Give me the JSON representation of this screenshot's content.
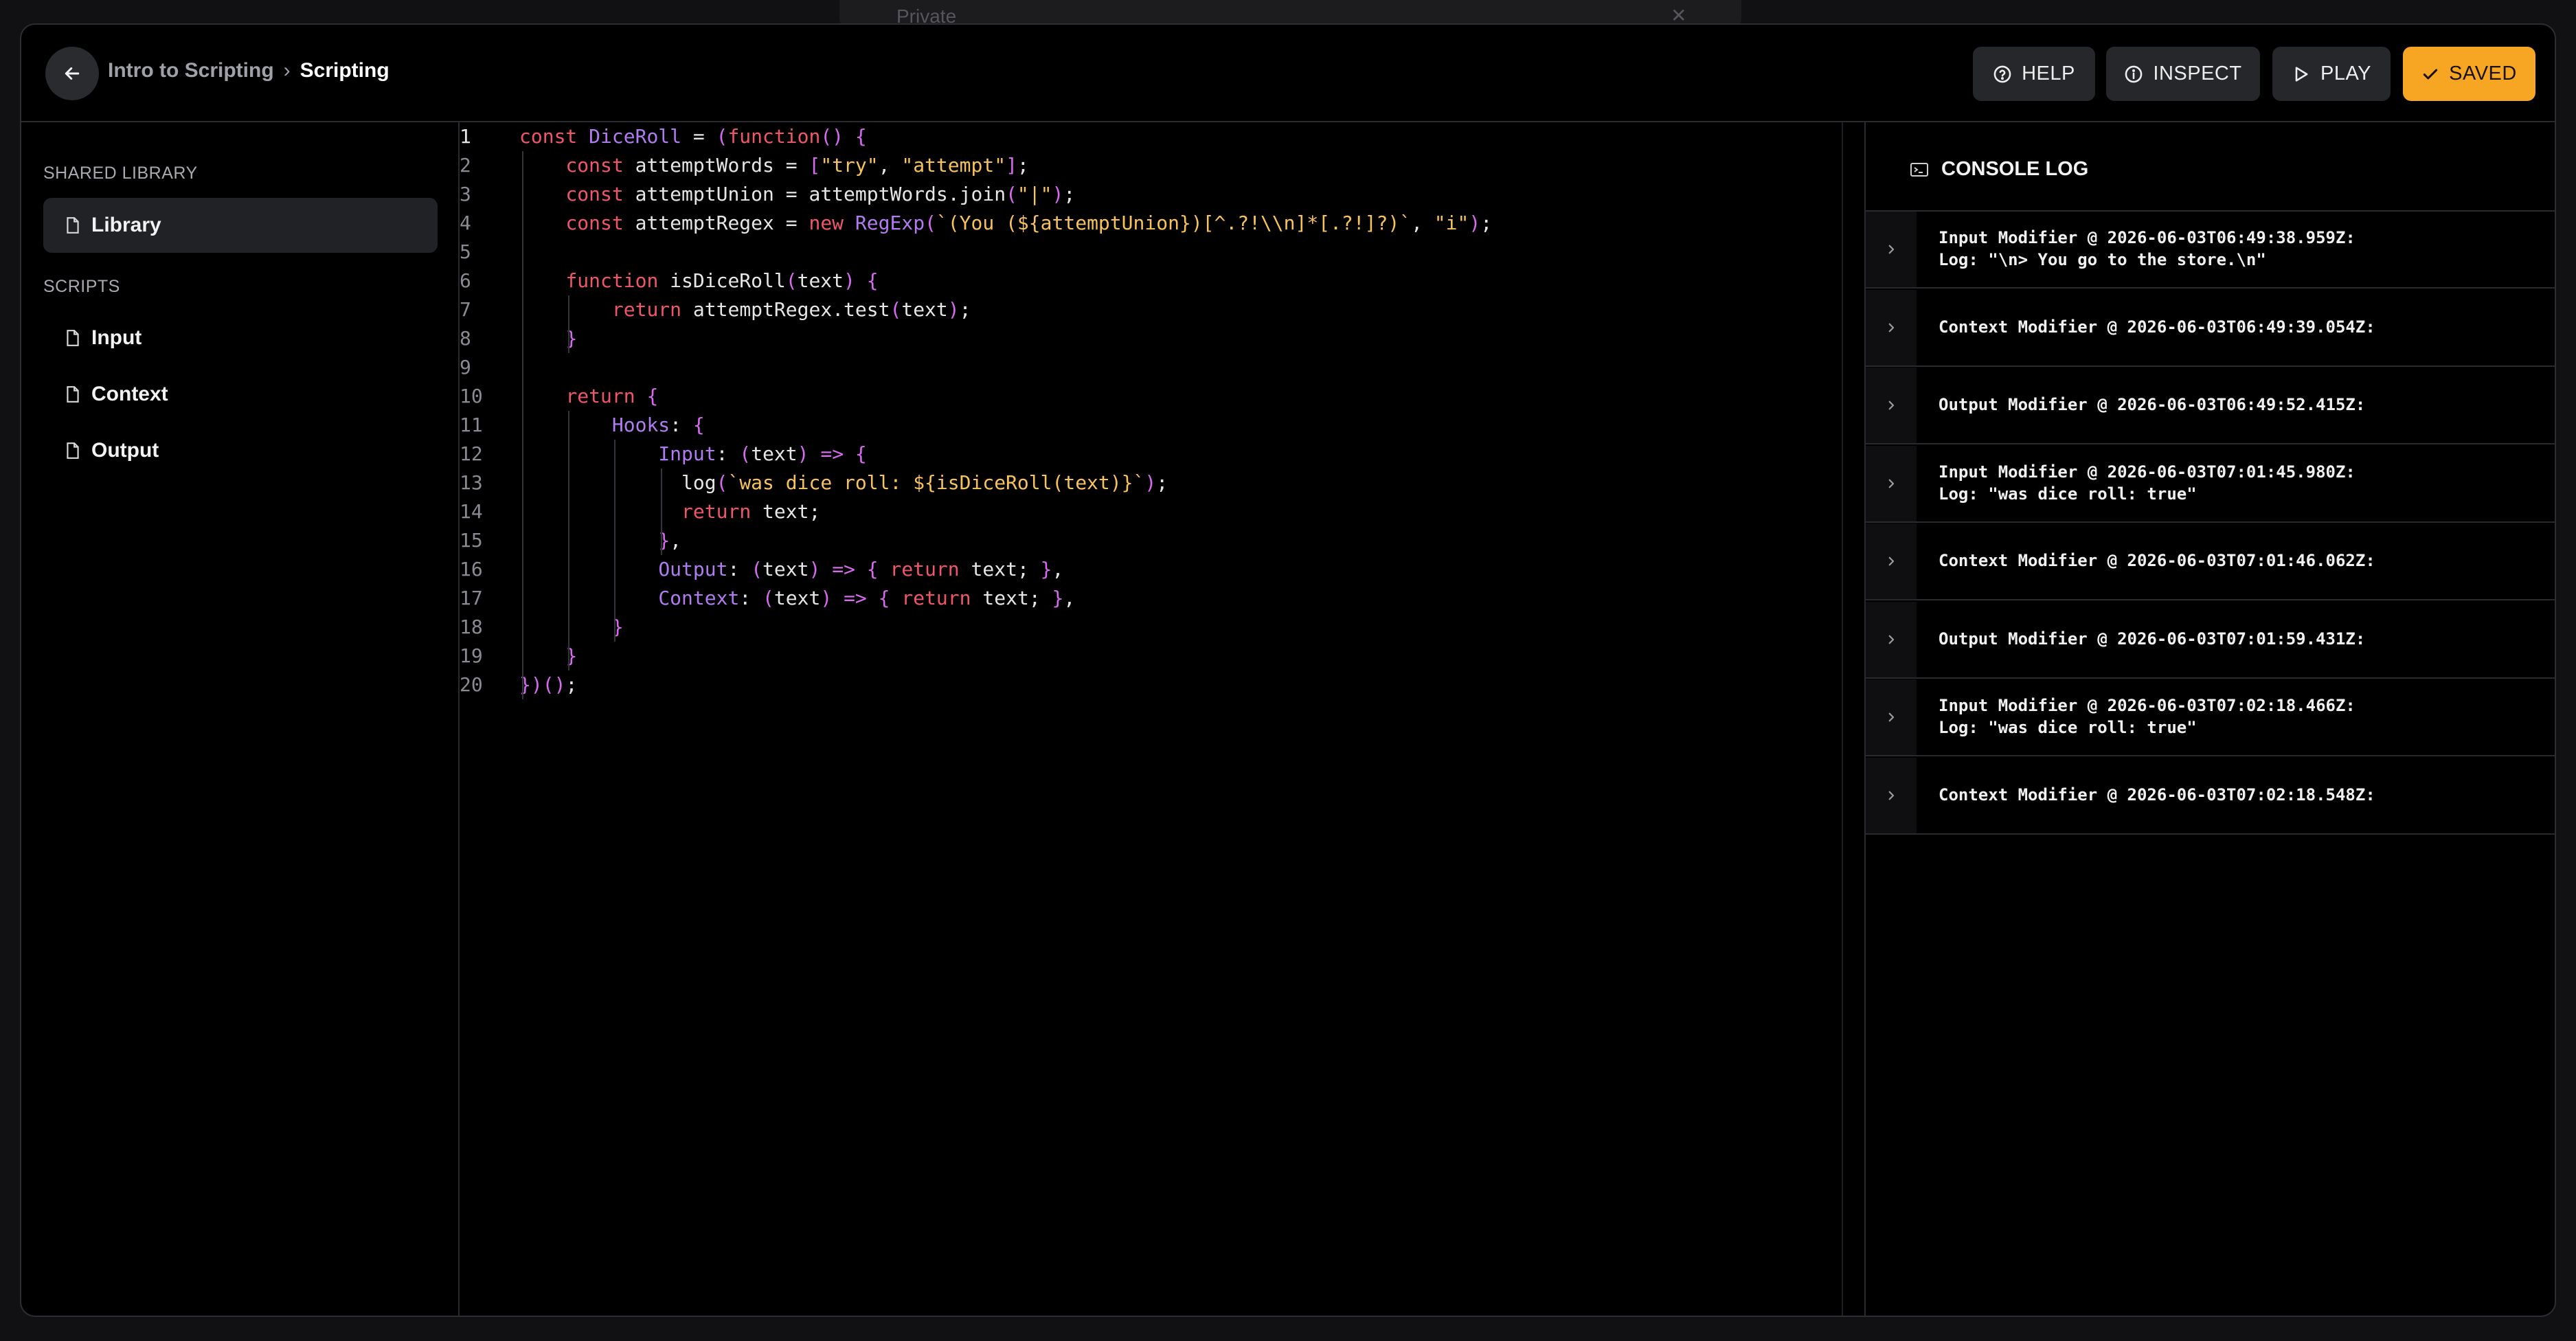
{
  "backdrop": {
    "privacy_value": "Private"
  },
  "header": {
    "breadcrumb": {
      "parent": "Intro to Scripting",
      "separator": "›",
      "current": "Scripting"
    },
    "buttons": {
      "help": "HELP",
      "inspect": "INSPECT",
      "play": "PLAY",
      "saved": "SAVED"
    }
  },
  "sidebar": {
    "shared_library_label": "SHARED LIBRARY",
    "library_item": "Library",
    "scripts_label": "SCRIPTS",
    "scripts": [
      "Input",
      "Context",
      "Output"
    ]
  },
  "editor": {
    "line_numbers": [
      "1",
      "2",
      "3",
      "4",
      "5",
      "6",
      "7",
      "8",
      "9",
      "10",
      "11",
      "12",
      "13",
      "14",
      "15",
      "16",
      "17",
      "18",
      "19",
      "20"
    ],
    "lines": [
      "const DiceRoll = (function() {",
      "    const attemptWords = [\"try\", \"attempt\"];",
      "    const attemptUnion = attemptWords.join(\"|\");",
      "    const attemptRegex = new RegExp(`(You (${attemptUnion})[^.?!\\\\n]*[.?!]?)`, \"i\");",
      "",
      "    function isDiceRoll(text) {",
      "        return attemptRegex.test(text);",
      "    }",
      "",
      "    return {",
      "        Hooks: {",
      "            Input: (text) => {",
      "              log(`was dice roll: ${isDiceRoll(text)}`);",
      "              return text;",
      "            },",
      "            Output: (text) => { return text; },",
      "            Context: (text) => { return text; },",
      "        }",
      "    }",
      "})();"
    ]
  },
  "console": {
    "title": "CONSOLE LOG",
    "entries": [
      "Input Modifier @ 2026-06-03T06:49:38.959Z:\nLog: \"\\n> You go to the store.\\n\"",
      "Context Modifier @ 2026-06-03T06:49:39.054Z:",
      "Output Modifier @ 2026-06-03T06:49:52.415Z:",
      "Input Modifier @ 2026-06-03T07:01:45.980Z:\nLog: \"was dice roll: true\"",
      "Context Modifier @ 2026-06-03T07:01:46.062Z:",
      "Output Modifier @ 2026-06-03T07:01:59.431Z:",
      "Input Modifier @ 2026-06-03T07:02:18.466Z:\nLog: \"was dice roll: true\"",
      "Context Modifier @ 2026-06-03T07:02:18.548Z:"
    ]
  },
  "colors": {
    "accent": "#f6a623",
    "keyword": "#f0566a",
    "function": "#b07cf0",
    "string": "#f7c35a"
  }
}
